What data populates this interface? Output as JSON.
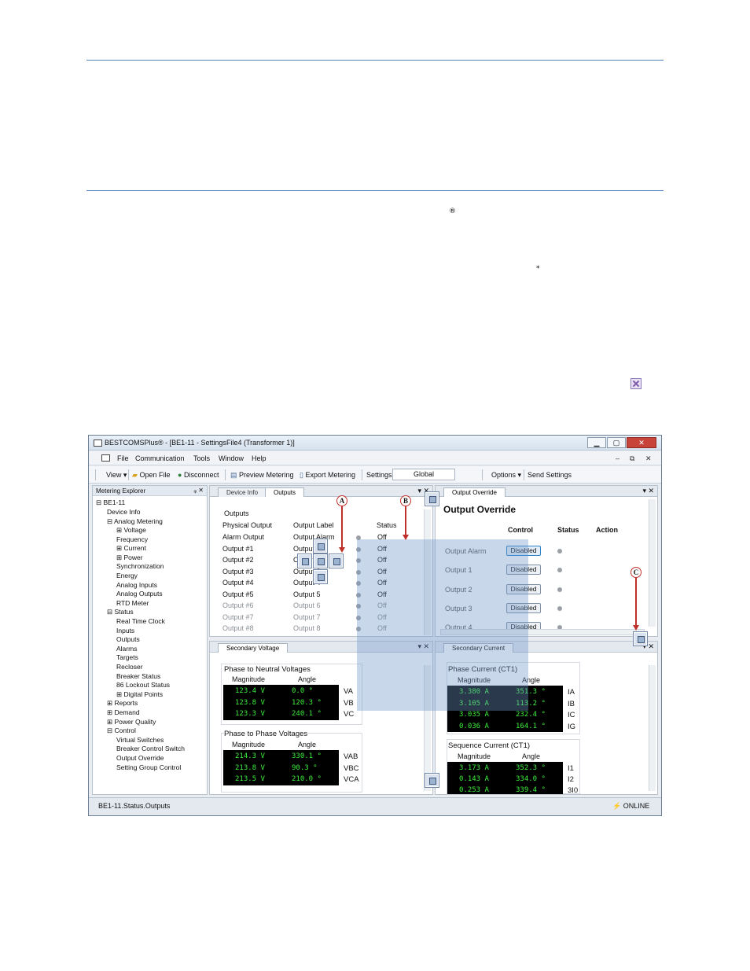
{
  "doc": {
    "registered_mark": "®",
    "asterisk": "*"
  },
  "window": {
    "title": "BESTCOMSPlus® - [BE1-11 - SettingsFile4 (Transformer 1)]",
    "controls": {
      "min": "▁",
      "max": "▢",
      "close": "✕"
    },
    "mdi_controls": {
      "min": "–",
      "restore": "⧉",
      "close": "✕"
    }
  },
  "menu": [
    "File",
    "Communication",
    "Tools",
    "Window",
    "Help"
  ],
  "toolbar": {
    "view": "View ▾",
    "open_file": "Open File",
    "disconnect": "Disconnect",
    "preview_metering": "Preview Metering",
    "export_metering": "Export Metering",
    "settings": "Settings",
    "settings_value": "Global",
    "options": "Options ▾",
    "send_settings": "Send Settings"
  },
  "explorer": {
    "title": "Metering Explorer",
    "pin": "ᵩ ✕",
    "items": [
      "⊟ BE1-11",
      "Device Info",
      "⊟ Analog Metering",
      "⊞ Voltage",
      "Frequency",
      "⊞ Current",
      "⊞ Power",
      "Synchronization",
      "Energy",
      "Analog Inputs",
      "Analog Outputs",
      "RTD Meter",
      "⊟ Status",
      "Real Time Clock",
      "Inputs",
      "Outputs",
      "Alarms",
      "Targets",
      "Recloser",
      "Breaker Status",
      "86 Lockout Status",
      "⊞ Digital Points",
      "⊞ Reports",
      "⊞ Demand",
      "⊞ Power Quality",
      "⊟ Control",
      "Virtual Switches",
      "Breaker Control Switch",
      "Output Override",
      "Setting Group Control"
    ]
  },
  "outputs_pane": {
    "tabs": [
      "Device Info",
      "Outputs"
    ],
    "heading": "Outputs",
    "col_physical": "Physical Output",
    "col_label": "Output Label",
    "col_status": "Status",
    "rows": [
      {
        "phys": "Alarm Output",
        "label": "Output Alarm",
        "status": "Off"
      },
      {
        "phys": "Output #1",
        "label": "Output 1",
        "status": "Off"
      },
      {
        "phys": "Output #2",
        "label": "Output 2",
        "status": "Off"
      },
      {
        "phys": "Output #3",
        "label": "Output 3",
        "status": "Off"
      },
      {
        "phys": "Output #4",
        "label": "Output 4",
        "status": "Off"
      },
      {
        "phys": "Output #5",
        "label": "Output 5",
        "status": "Off"
      },
      {
        "phys": "Output #6",
        "label": "Output 6",
        "status": "Off"
      },
      {
        "phys": "Output #7",
        "label": "Output 7",
        "status": "Off"
      },
      {
        "phys": "Output #8",
        "label": "Output 8",
        "status": "Off"
      }
    ]
  },
  "override_pane": {
    "tab": "Output Override",
    "heading": "Output Override",
    "col_control": "Control",
    "col_status": "Status",
    "col_action": "Action",
    "rows": [
      {
        "label": "Output Alarm",
        "control": "Disabled"
      },
      {
        "label": "Output 1",
        "control": "Disabled"
      },
      {
        "label": "Output 2",
        "control": "Disabled"
      },
      {
        "label": "Output 3",
        "control": "Disabled"
      },
      {
        "label": "Output 4",
        "control": "Disabled"
      }
    ]
  },
  "voltage_pane": {
    "tab": "Secondary Voltage",
    "group1": "Phase to Neutral Voltages",
    "group2": "Phase to Phase Voltages",
    "col_mag": "Magnitude",
    "col_ang": "Angle",
    "neutral": [
      {
        "mag": "123.4 V",
        "ang": "0.0 °",
        "name": "VA"
      },
      {
        "mag": "123.8 V",
        "ang": "120.3 °",
        "name": "VB"
      },
      {
        "mag": "123.3 V",
        "ang": "240.1 °",
        "name": "VC"
      }
    ],
    "phase": [
      {
        "mag": "214.3 V",
        "ang": "330.1 °",
        "name": "VAB"
      },
      {
        "mag": "213.8 V",
        "ang": "90.3 °",
        "name": "VBC"
      },
      {
        "mag": "213.5 V",
        "ang": "210.0 °",
        "name": "VCA"
      }
    ]
  },
  "current_pane": {
    "tab": "Secondary Current",
    "group1": "Phase Current (CT1)",
    "group2": "Sequence Current (CT1)",
    "col_mag": "Magnitude",
    "col_ang": "Angle",
    "phase": [
      {
        "mag": "3.380 A",
        "ang": "351.3 °",
        "name": "IA"
      },
      {
        "mag": "3.105 A",
        "ang": "113.2 °",
        "name": "IB"
      },
      {
        "mag": "3.035 A",
        "ang": "232.4 °",
        "name": "IC"
      },
      {
        "mag": "0.036 A",
        "ang": "164.1 °",
        "name": "IG"
      }
    ],
    "sequence": [
      {
        "mag": "3.173 A",
        "ang": "352.3 °",
        "name": "I1"
      },
      {
        "mag": "0.143 A",
        "ang": "334.0 °",
        "name": "I2"
      },
      {
        "mag": "0.253 A",
        "ang": "339.4 °",
        "name": "3I0"
      }
    ]
  },
  "callouts": {
    "a": "A",
    "b": "B",
    "c": "C"
  },
  "statusbar": {
    "path": "BE1-11.Status.Outputs",
    "online": "ONLINE"
  }
}
